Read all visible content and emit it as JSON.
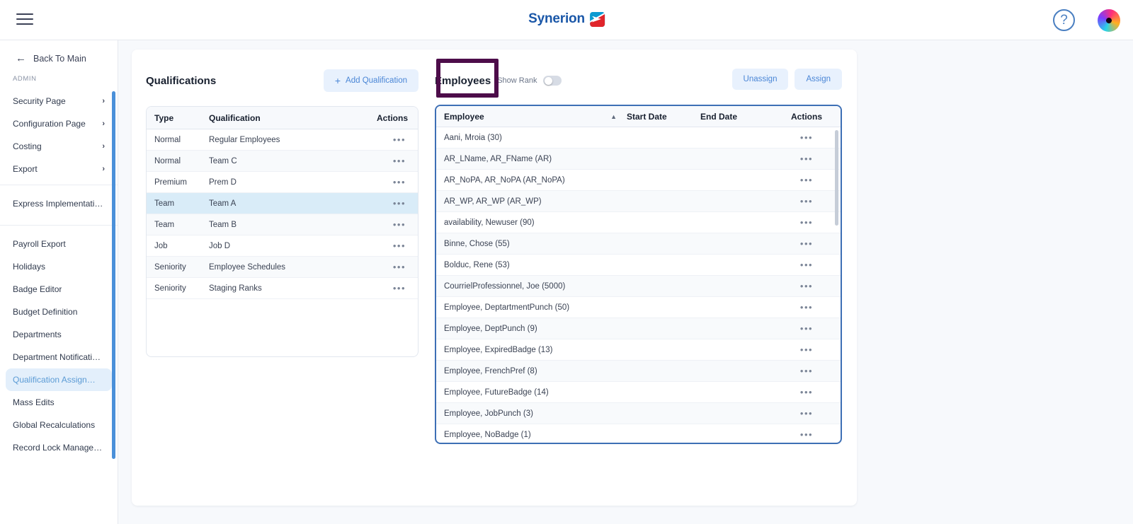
{
  "header": {
    "brand_name": "Synerion",
    "menu_icon": "hamburger-icon",
    "help_icon": "?",
    "avatar_alt": "user-avatar"
  },
  "sidebar": {
    "back_label": "Back To Main",
    "back_icon": "arrow-left-icon",
    "section_label": "ADMIN",
    "expandable": [
      {
        "label": "Security Page",
        "chevron": "›"
      },
      {
        "label": "Configuration Page",
        "chevron": "›"
      },
      {
        "label": "Costing",
        "chevron": "›"
      },
      {
        "label": "Export",
        "chevron": "›"
      }
    ],
    "middle": [
      {
        "label": "Express Implementation P..."
      }
    ],
    "items": [
      {
        "label": "Payroll Export",
        "active": false
      },
      {
        "label": "Holidays",
        "active": false
      },
      {
        "label": "Badge Editor",
        "active": false
      },
      {
        "label": "Budget Definition",
        "active": false
      },
      {
        "label": "Departments",
        "active": false
      },
      {
        "label": "Department Notifications",
        "active": false
      },
      {
        "label": "Qualification Assignments",
        "active": true
      },
      {
        "label": "Mass Edits",
        "active": false
      },
      {
        "label": "Global Recalculations",
        "active": false
      },
      {
        "label": "Record Lock Management",
        "active": false
      }
    ]
  },
  "qualifications": {
    "title": "Qualifications",
    "add_button": "Add Qualification",
    "add_icon": "plus-icon",
    "columns": [
      "Type",
      "Qualification",
      "Actions"
    ],
    "action_glyph": "•••",
    "rows": [
      {
        "type": "Normal",
        "qualification": "Regular Employees",
        "selected": false
      },
      {
        "type": "Normal",
        "qualification": "Team C",
        "selected": false
      },
      {
        "type": "Premium",
        "qualification": "Prem D",
        "selected": false
      },
      {
        "type": "Team",
        "qualification": "Team A",
        "selected": true
      },
      {
        "type": "Team",
        "qualification": "Team B",
        "selected": false
      },
      {
        "type": "Job",
        "qualification": "Job D",
        "selected": false
      },
      {
        "type": "Seniority",
        "qualification": "Employee Schedules",
        "selected": false
      },
      {
        "type": "Seniority",
        "qualification": "Staging Ranks",
        "selected": false
      }
    ]
  },
  "employees": {
    "title": "Employees",
    "show_rank_label": "Show Rank",
    "show_rank_on": false,
    "unassign_button": "Unassign",
    "assign_button": "Assign",
    "highlight_color": "#4d0d4a",
    "sort_caret": "▲",
    "columns": [
      "Employee",
      "Start Date",
      "End Date",
      "Actions"
    ],
    "action_glyph": "•••",
    "rows": [
      {
        "employee": "Aani, Mroia (30)",
        "start_date": "",
        "end_date": ""
      },
      {
        "employee": "AR_LName, AR_FName (AR)",
        "start_date": "",
        "end_date": ""
      },
      {
        "employee": "AR_NoPA, AR_NoPA (AR_NoPA)",
        "start_date": "",
        "end_date": ""
      },
      {
        "employee": "AR_WP, AR_WP (AR_WP)",
        "start_date": "",
        "end_date": ""
      },
      {
        "employee": "availability, Newuser (90)",
        "start_date": "",
        "end_date": ""
      },
      {
        "employee": "Binne, Chose (55)",
        "start_date": "",
        "end_date": ""
      },
      {
        "employee": "Bolduc, Rene (53)",
        "start_date": "",
        "end_date": ""
      },
      {
        "employee": "CourrielProfessionnel, Joe (5000)",
        "start_date": "",
        "end_date": ""
      },
      {
        "employee": "Employee, DeptartmentPunch (50)",
        "start_date": "",
        "end_date": ""
      },
      {
        "employee": "Employee, DeptPunch (9)",
        "start_date": "",
        "end_date": ""
      },
      {
        "employee": "Employee, ExpiredBadge (13)",
        "start_date": "",
        "end_date": ""
      },
      {
        "employee": "Employee, FrenchPref (8)",
        "start_date": "",
        "end_date": ""
      },
      {
        "employee": "Employee, FutureBadge (14)",
        "start_date": "",
        "end_date": ""
      },
      {
        "employee": "Employee, JobPunch (3)",
        "start_date": "",
        "end_date": ""
      },
      {
        "employee": "Employee, NoBadge (1)",
        "start_date": "",
        "end_date": ""
      }
    ]
  },
  "colors": {
    "accent_blue": "#4a86d6",
    "pill_bg": "#e8f1fd",
    "selected_row": "#d9ecf8",
    "sidebar_active": "#e3effb",
    "highlight_purple": "#4d0d4a",
    "brand_blue": "#1a57a8"
  }
}
